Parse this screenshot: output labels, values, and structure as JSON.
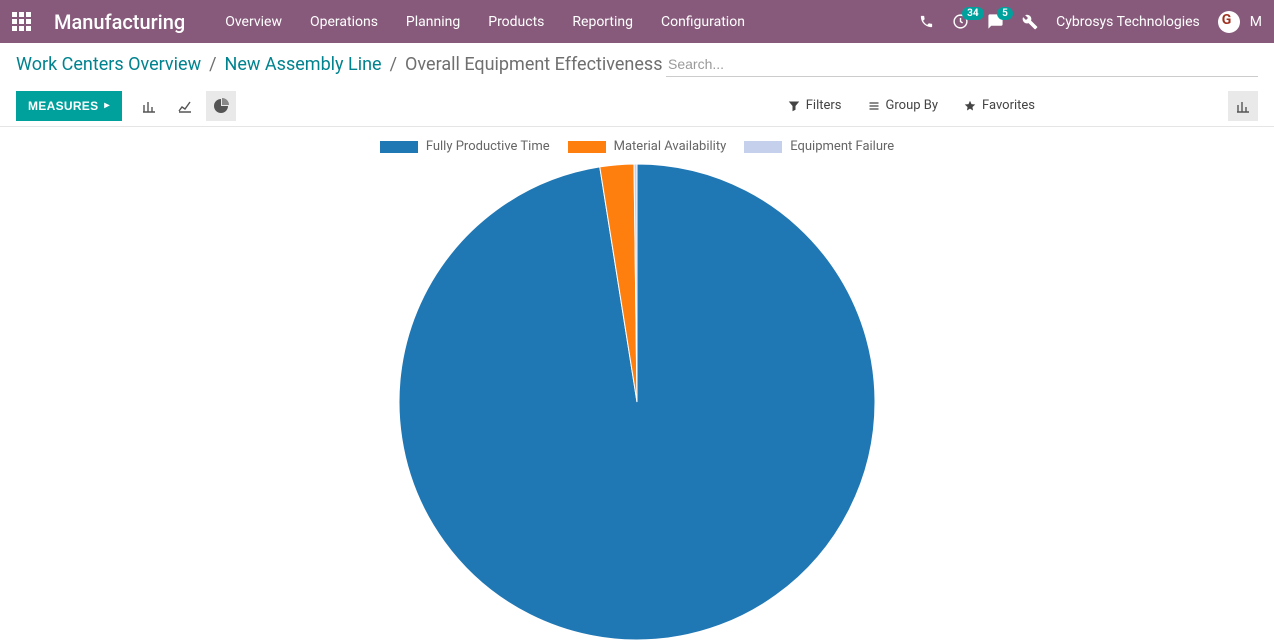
{
  "navbar": {
    "brand": "Manufacturing",
    "items": [
      "Overview",
      "Operations",
      "Planning",
      "Products",
      "Reporting",
      "Configuration"
    ],
    "activity_badge": "34",
    "chat_badge": "5",
    "username": "Cybrosys Technologies",
    "user_initial": "M"
  },
  "breadcrumb": {
    "items": [
      {
        "label": "Work Centers Overview",
        "link": true
      },
      {
        "label": "New Assembly Line",
        "link": true
      },
      {
        "label": "Overall Equipment Effectiveness",
        "link": false
      }
    ]
  },
  "search": {
    "placeholder": "Search..."
  },
  "toolbar": {
    "measures_label": "MEASURES",
    "filters_label": "Filters",
    "groupby_label": "Group By",
    "favorites_label": "Favorites"
  },
  "chart_data": {
    "type": "pie",
    "title": "",
    "series": [
      {
        "name": "Fully Productive Time",
        "value": 97.5,
        "color": "#1f77b4"
      },
      {
        "name": "Material Availability",
        "value": 2.3,
        "color": "#ff7f0e"
      },
      {
        "name": "Equipment Failure",
        "value": 0.2,
        "color": "#c5d0ec"
      }
    ]
  },
  "colors": {
    "primary": "#00A09D",
    "navbar": "#875A7B"
  }
}
